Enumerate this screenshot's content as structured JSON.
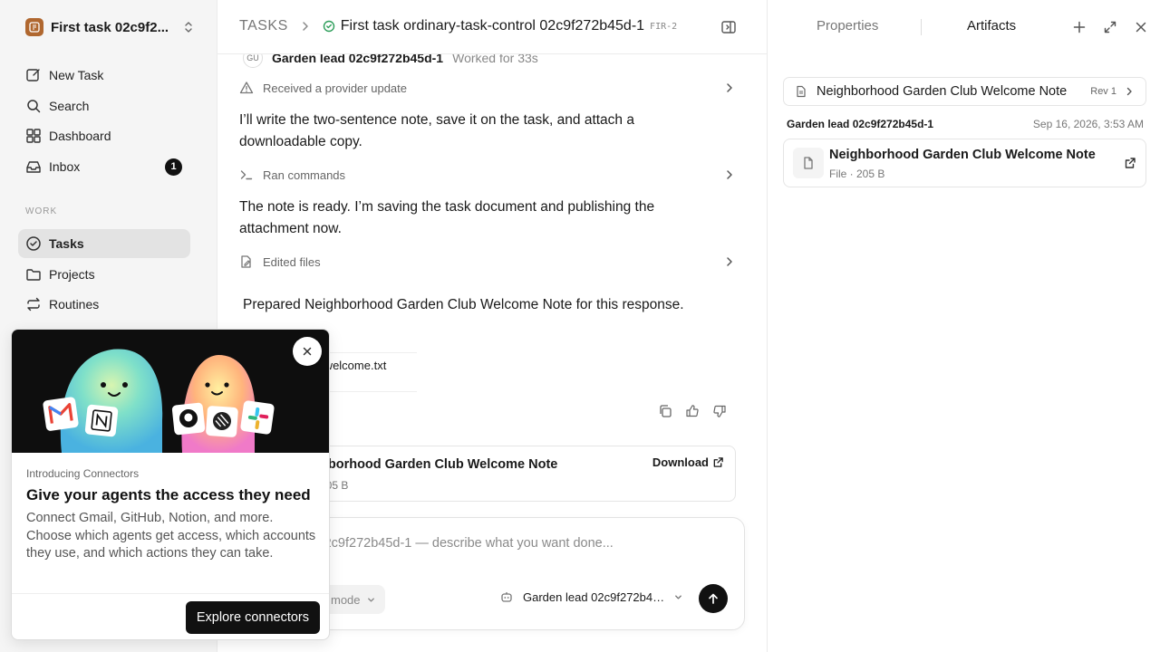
{
  "sidebar": {
    "workspace_name": "First task 02c9f2...",
    "nav": [
      {
        "label": "New Task",
        "icon": "new-task-icon"
      },
      {
        "label": "Search",
        "icon": "search-icon"
      },
      {
        "label": "Dashboard",
        "icon": "dashboard-icon"
      },
      {
        "label": "Inbox",
        "icon": "inbox-icon",
        "badge": "1"
      }
    ],
    "section_label": "WORK",
    "work": [
      {
        "label": "Tasks",
        "icon": "check-circle-icon",
        "active": true
      },
      {
        "label": "Projects",
        "icon": "folder-icon"
      },
      {
        "label": "Routines",
        "icon": "repeat-icon"
      }
    ]
  },
  "header": {
    "root": "TASKS",
    "title": "First task ordinary-task-control 02c9f272b45d-1",
    "code": "FIR-2"
  },
  "thread": {
    "agent_initials": "GU",
    "agent_name": "Garden lead 02c9f272b45d-1",
    "worked": "Worked for 33s",
    "activity_1": "Received a provider update",
    "message_1": "I’ll write the two-sentence note, save it on the task, and attach a downloadable copy.",
    "activity_2": "Ran commands",
    "message_2": "The note is ready. I’m saving the task document and publishing the attachment now.",
    "activity_3": "Edited files",
    "message_3": "Prepared Neighborhood Garden Club Welcome Note for this response.",
    "file_chip_name": "lub-welcome.txt",
    "file_chip_size": "5 B",
    "download_card_name": "nborhood Garden Club Welcome Note",
    "download_card_size": "205 B",
    "download_label": "Download"
  },
  "composer": {
    "placeholder": "arden lead 02c9f272b45d-1 — describe what you want done...",
    "mode_label": "mode",
    "agent_label": "Garden lead 02c9f272b45d-1"
  },
  "right_panel": {
    "tab_properties": "Properties",
    "tab_artifacts": "Artifacts",
    "doc_title": "Neighborhood Garden Club Welcome Note",
    "doc_rev": "Rev 1",
    "meta_author": "Garden lead 02c9f272b45d-1",
    "meta_date": "Sep 16, 2026, 3:53 AM",
    "artifact_name": "Neighborhood Garden Club Welcome Note",
    "artifact_meta": "File · 205 B"
  },
  "popup": {
    "eyebrow": "Introducing Connectors",
    "title": "Give your agents the access they need",
    "description": "Connect Gmail, GitHub, Notion, and more. Choose which agents get access, which accounts they use, and which actions they can take.",
    "cta": "Explore connectors"
  },
  "colors": {
    "accent_dark": "#111111",
    "status_green": "#2e9e5b",
    "sidebar_bg": "#f5f5f5"
  }
}
